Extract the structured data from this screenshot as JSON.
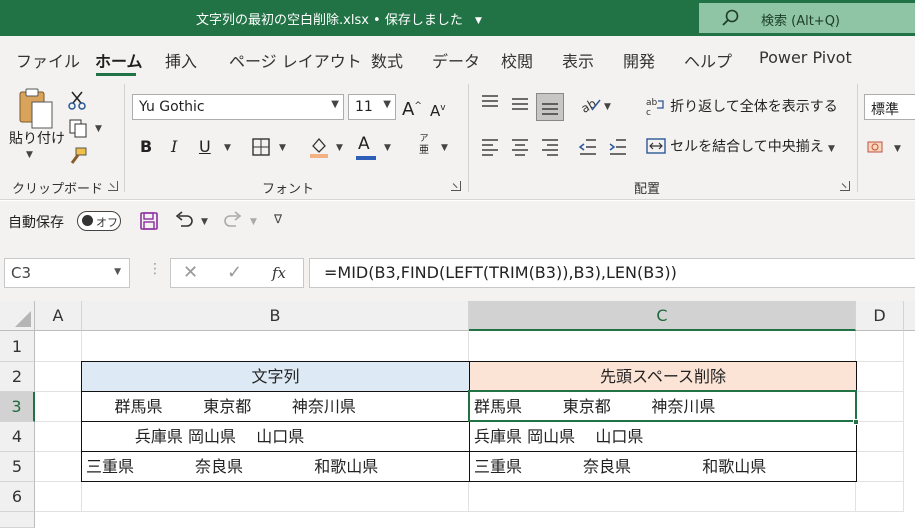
{
  "titlebar": {
    "title": "文字列の最初の空白削除.xlsx • 保存しました",
    "search_label": "検索 (Alt+Q)"
  },
  "tabs": [
    "ファイル",
    "ホーム",
    "挿入",
    "ページ レイアウト",
    "数式",
    "データ",
    "校閲",
    "表示",
    "開発",
    "ヘルプ",
    "Power Pivot"
  ],
  "active_tab": "ホーム",
  "ribbon": {
    "paste_label": "貼り付け",
    "clipboard_group": "クリップボード",
    "font_name": "Yu Gothic",
    "font_size": "11",
    "bold": "B",
    "italic": "I",
    "underline": "U",
    "font_group": "フォント",
    "wrap_text": "折り返して全体を表示する",
    "merge_center": "セルを結合して中央揃え",
    "alignment_group": "配置",
    "number_format": "標準",
    "phonetic_top": "ア",
    "phonetic_bottom": "亜",
    "grow_font": "A",
    "shrink_font": "A",
    "font_color_letter": "A"
  },
  "qat": {
    "autosave_label": "自動保存",
    "autosave_state": "オフ"
  },
  "formula_bar": {
    "name_box": "C3",
    "fx": "fx",
    "formula": "=MID(B3,FIND(LEFT(TRIM(B3)),B3),LEN(B3))"
  },
  "sheet": {
    "columns": [
      "A",
      "B",
      "C",
      "D"
    ],
    "rows": [
      "1",
      "2",
      "3",
      "4",
      "5",
      "6"
    ],
    "selected_column": "C",
    "selected_row": "3",
    "cells": {
      "B2": "文字列",
      "C2": "先頭スペース削除",
      "B3": "      群馬県        東京都        神奈川県",
      "C3": "群馬県        東京都        神奈川県",
      "B4": "          兵庫県 岡山県    山口県",
      "C4": "兵庫県 岡山県    山口県",
      "B5": "三重県            奈良県              和歌山県",
      "C5": "三重県            奈良県              和歌山県"
    }
  },
  "colors": {
    "accent": "#217346",
    "header_b_fill": "#dde9f4",
    "header_c_fill": "#fbe3d6"
  }
}
